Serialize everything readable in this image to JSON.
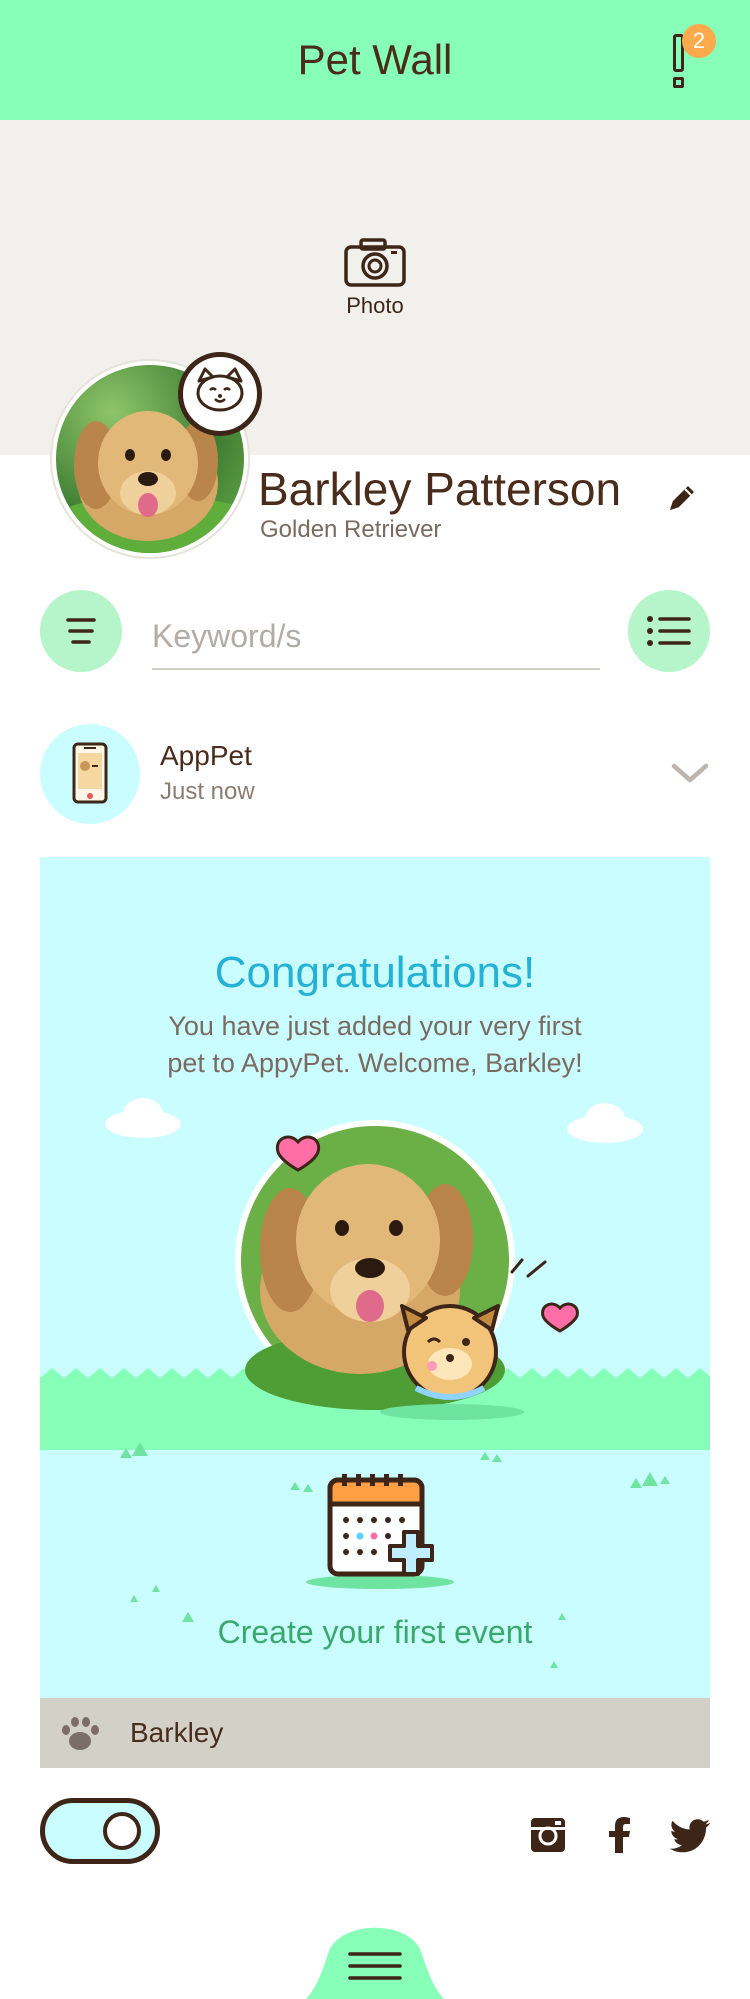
{
  "header": {
    "title": "Pet Wall",
    "notification_count": "2"
  },
  "cover": {
    "photo_label": "Photo"
  },
  "profile": {
    "name": "Barkley Patterson",
    "breed": "Golden Retriever"
  },
  "search": {
    "placeholder": "Keyword/s"
  },
  "post": {
    "author": "AppPet",
    "time": "Just now",
    "card": {
      "title": "Congratulations!",
      "message": "You have just added your very first pet to AppyPet. Welcome, Barkley!",
      "event_label": "Create your first event",
      "footer_pet_name": "Barkley"
    }
  },
  "icons": {
    "alert": "exclamation-icon",
    "camera": "camera-icon",
    "pet": "dog-face-icon",
    "edit": "pencil-icon",
    "filter": "filter-icon",
    "list": "list-icon",
    "chevron": "chevron-down-icon",
    "phone": "phone-icon",
    "calendar": "calendar-plus-icon",
    "paw": "paw-icon",
    "instagram": "instagram-icon",
    "facebook": "facebook-icon",
    "twitter": "twitter-icon",
    "menu": "hamburger-icon"
  },
  "colors": {
    "brand_green": "#88ffb8",
    "light_cyan": "#c9fdff",
    "accent_blue": "#25b0d6",
    "badge_orange": "#ffa94d",
    "dark_brown": "#3d2618"
  }
}
